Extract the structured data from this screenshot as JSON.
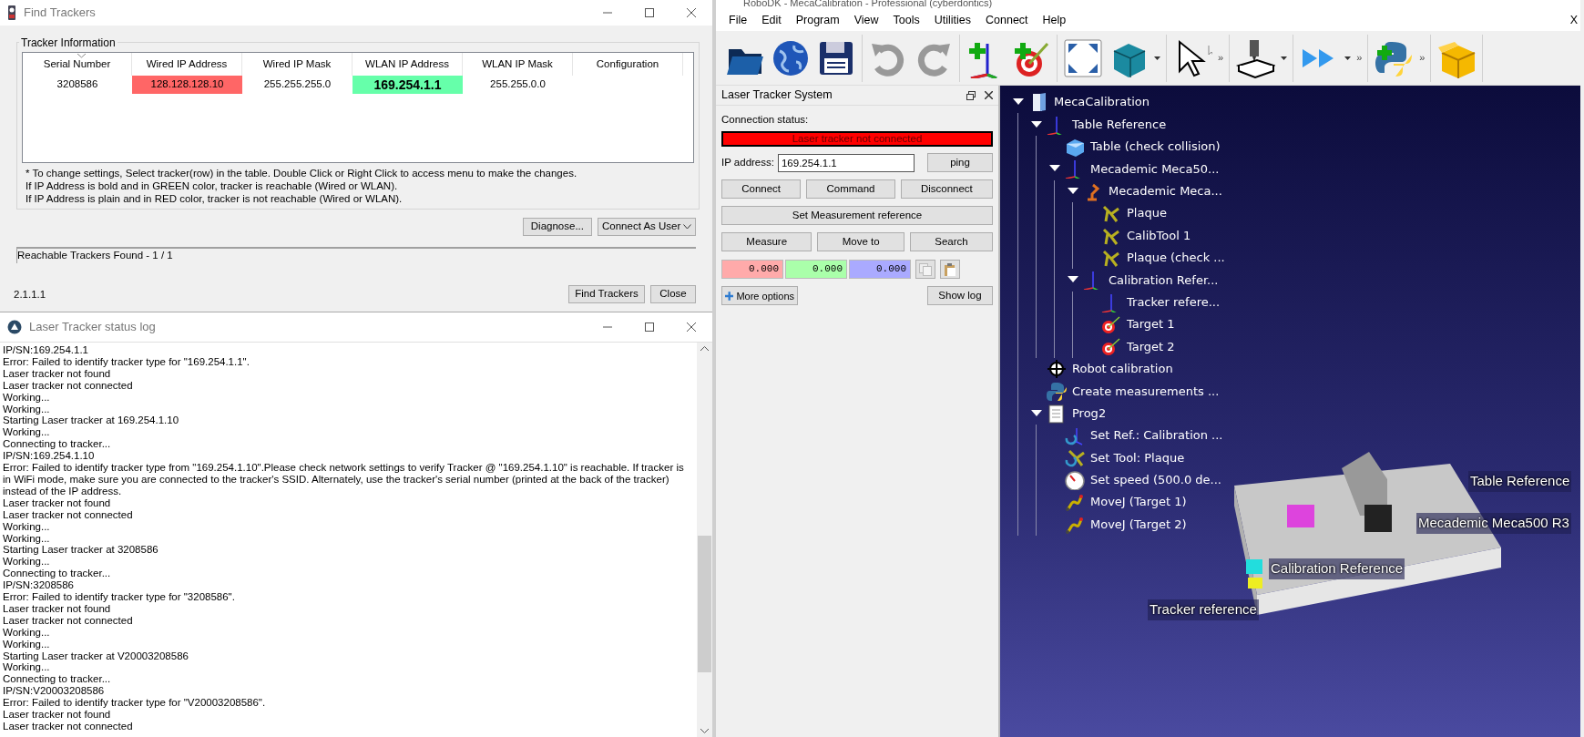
{
  "find_trackers": {
    "title": "Find Trackers",
    "group_label": "Tracker Information",
    "columns": [
      {
        "label": "Serial Number",
        "sorted": true
      },
      {
        "label": "Wired IP Address",
        "sorted": false
      },
      {
        "label": "Wired IP Mask",
        "sorted": false
      },
      {
        "label": "WLAN IP Address",
        "sorted": false
      },
      {
        "label": "WLAN IP Mask",
        "sorted": false
      },
      {
        "label": "Configuration",
        "sorted": false
      }
    ],
    "rows": [
      {
        "cells": [
          {
            "text": "3208586"
          },
          {
            "text": "128.128.128.10",
            "reachable": false
          },
          {
            "text": "255.255.255.0"
          },
          {
            "text": "169.254.1.1",
            "reachable": true
          },
          {
            "text": "255.255.0.0"
          }
        ]
      }
    ],
    "notes": [
      "* To change settings, Select tracker(row) in the table. Double Click or Right Click to access menu to make the changes.",
      "If IP Address is bold and in GREEN color, tracker is reachable (Wired or WLAN).",
      "If IP Address is plain and in RED color, tracker is not reachable (Wired or WLAN)."
    ],
    "diagnose_button": "Diagnose...",
    "connect_mode": "Connect As User",
    "status_text": "Reachable Trackers Found - 1 / 1",
    "version": "2.1.1.1",
    "buttons": [
      "Find Trackers",
      "Close"
    ]
  },
  "status_log": {
    "title": "Laser Tracker status log",
    "lines": [
      "IP/SN:169.254.1.1",
      "Error: Failed to identify tracker type for \"169.254.1.1\".",
      "Laser tracker not found",
      "Laser tracker not connected",
      "Working...",
      "Working...",
      "Starting Laser tracker at 169.254.1.10",
      "Working...",
      "Connecting to tracker...",
      "IP/SN:169.254.1.10",
      "Error: Failed to identify tracker type from \"169.254.1.10\".Please check network settings to verify Tracker @ \"169.254.1.10\" is reachable. If tracker is in WiFi mode, make sure you are connected to the tracker's SSID. Alternately, use the tracker's serial number (printed at the back of the tracker) instead of the IP address.",
      "Laser tracker not found",
      "Laser tracker not connected",
      "Working...",
      "Working...",
      "Starting Laser tracker at 3208586",
      "Working...",
      "Connecting to tracker...",
      "IP/SN:3208586",
      "Error: Failed to identify tracker type for \"3208586\".",
      "Laser tracker not found",
      "Laser tracker not connected",
      "Working...",
      "Working...",
      "Starting Laser tracker at V20003208586",
      "Working...",
      "Connecting to tracker...",
      "IP/SN:V20003208586",
      "Error: Failed to identify tracker type for \"V20003208586\".",
      "Laser tracker not found",
      "Laser tracker not connected"
    ]
  },
  "robodk": {
    "title": "RoboDK - MecaCalibration - Professional (cyberdontics)",
    "menu": [
      "File",
      "Edit",
      "Program",
      "View",
      "Tools",
      "Utilities",
      "Connect",
      "Help"
    ],
    "menu_close": "X",
    "toolbar_overflow": [
      "»",
      "»",
      "»"
    ]
  },
  "laser_panel": {
    "title": "Laser Tracker System",
    "connection_label": "Connection status:",
    "connection_status": "Laser tracker not connected",
    "connected": false,
    "ip_label": "IP address:",
    "ip_value": "169.254.1.1",
    "ping_button": "ping",
    "button_rows": [
      [
        "Connect",
        "Command",
        "Disconnect"
      ],
      [
        "Set Measurement reference"
      ],
      [
        "Measure",
        "Move to",
        "Search"
      ]
    ],
    "coordinates": [
      {
        "value": "0.000",
        "color": "#ffaaaa"
      },
      {
        "value": "0.000",
        "color": "#aaffaa"
      },
      {
        "value": "0.000",
        "color": "#aaaaff"
      }
    ],
    "more_options": "More options",
    "show_log": "Show log"
  },
  "tree": [
    {
      "label": "MecaCalibration",
      "kind": "station",
      "expanded": true,
      "children": [
        {
          "label": "Table Reference",
          "kind": "frame",
          "expanded": true,
          "children": [
            {
              "label": "Table (check collision)",
              "kind": "object"
            },
            {
              "label": "Mecademic Meca50...",
              "kind": "frame",
              "expanded": true,
              "children": [
                {
                  "label": "Mecademic Meca...",
                  "kind": "robot",
                  "expanded": true,
                  "children": [
                    {
                      "label": "Plaque",
                      "kind": "tool"
                    },
                    {
                      "label": "CalibTool 1",
                      "kind": "tool"
                    },
                    {
                      "label": "Plaque (check ...",
                      "kind": "tool"
                    }
                  ]
                },
                {
                  "label": "Calibration Refer...",
                  "kind": "frame",
                  "expanded": true,
                  "children": [
                    {
                      "label": "Tracker refere...",
                      "kind": "frame"
                    },
                    {
                      "label": "Target 1",
                      "kind": "target"
                    },
                    {
                      "label": "Target 2",
                      "kind": "target"
                    }
                  ]
                }
              ]
            }
          ]
        },
        {
          "label": "Robot calibration",
          "kind": "calibration"
        },
        {
          "label": "Create measurements ...",
          "kind": "script"
        },
        {
          "label": "Prog2",
          "kind": "program",
          "expanded": true,
          "children": [
            {
              "label": "Set Ref.: Calibration ...",
              "kind": "set_frame"
            },
            {
              "label": "Set Tool: Plaque",
              "kind": "set_tool"
            },
            {
              "label": "Set speed (500.0 de...",
              "kind": "speed"
            },
            {
              "label": "MoveJ (Target 1)",
              "kind": "move"
            },
            {
              "label": "MoveJ (Target 2)",
              "kind": "move"
            }
          ]
        }
      ]
    }
  ],
  "scene_labels": [
    "Table Reference",
    "Mecademic Meca500 R3",
    "Calibration Reference",
    "Tracker reference"
  ]
}
